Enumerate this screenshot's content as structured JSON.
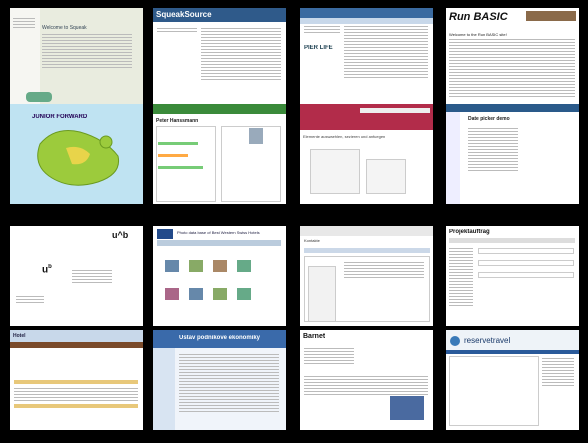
{
  "gallery": {
    "tiles": [
      {
        "name": "squeak-welcome",
        "title": "Welcome to Squeak"
      },
      {
        "name": "squeaksource",
        "title": "SqueakSource"
      },
      {
        "name": "pier-site",
        "title": "PIER LIFE"
      },
      {
        "name": "run-basic",
        "title": "Run BASIC",
        "subtitle": "Welcome to the Run BASIC site!"
      },
      {
        "name": "junior-map",
        "title": "JUNIOR FORWARD"
      },
      {
        "name": "wbooks-profile",
        "title": "Peter Hanssmann"
      },
      {
        "name": "elements-page",
        "title": "Elemente auswaehlen, sezieren und anfuegen"
      },
      {
        "name": "date-picker-demo",
        "title": "Date picker demo"
      },
      {
        "name": "ub-letterhead",
        "title": "u^b"
      },
      {
        "name": "best-western-photos",
        "title": "Photo data base of Best Western Swiss Hotels"
      },
      {
        "name": "admin-grid",
        "title": "Kontakte"
      },
      {
        "name": "project-form",
        "title": "Projektauftrag"
      },
      {
        "name": "hotel-table",
        "title": "Hotel"
      },
      {
        "name": "ustav-economics",
        "title": "Ustav podnikove ekonomiky"
      },
      {
        "name": "barnet-store",
        "title": "Barnet"
      },
      {
        "name": "reserve-travel",
        "title": "reservetravel"
      }
    ]
  }
}
